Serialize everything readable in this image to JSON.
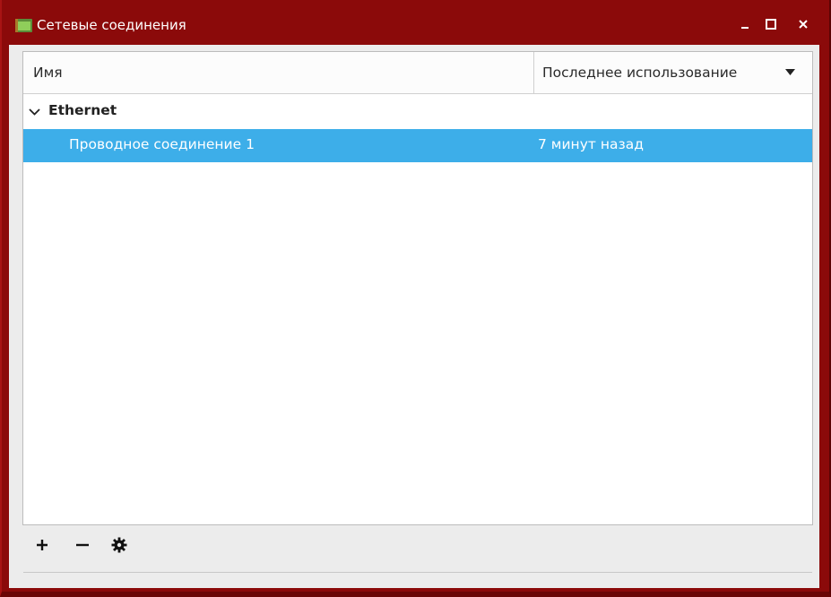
{
  "window": {
    "title": "Сетевые соединения",
    "icons": {
      "app": "network-connections-icon",
      "minimize": "minimize-icon",
      "maximize": "maximize-icon",
      "close": "close-icon"
    },
    "colors": {
      "titlebar": "#8b0a0a",
      "selection": "#3daee9"
    }
  },
  "list": {
    "columns": {
      "name": "Имя",
      "last_used": "Последнее использование"
    },
    "sort_indicator": "sort-descending-icon",
    "groups": [
      {
        "label": "Ethernet",
        "expanded": true,
        "connections": [
          {
            "name": "Проводное соединение 1",
            "last_used": "7 минут назад",
            "selected": true
          }
        ]
      }
    ]
  },
  "toolbar": {
    "add": "add-icon",
    "remove": "remove-icon",
    "edit": "gear-icon"
  }
}
